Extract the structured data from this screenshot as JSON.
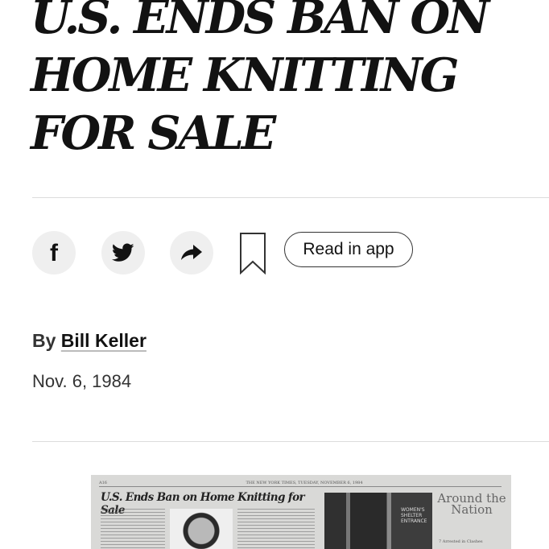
{
  "article": {
    "headline": "U.S. ENDS BAN ON HOME KNITTING FOR SALE",
    "byline_prefix": "By",
    "author": "Bill Keller",
    "date": "Nov. 6, 1984"
  },
  "share_bar": {
    "facebook_icon": "f",
    "read_in_app_label": "Read in app",
    "icons": [
      "facebook-icon",
      "twitter-icon",
      "share-arrow-icon",
      "bookmark-icon"
    ]
  },
  "clipping": {
    "page_header": "THE NEW YORK TIMES, TUESDAY, NOVEMBER 6, 1984",
    "page_number": "A16",
    "title": "U.S. Ends Ban on Home Knitting for Sale",
    "sign_text": "WOMEN'S SHELTER ENTRANCE",
    "nation_label": "Around the Nation",
    "nation_sub": "7 Arrested in Clashes"
  },
  "colors": {
    "text": "#121212",
    "circle_bg": "#efefef",
    "rule": "#dcdcdc",
    "clipping_bg": "#d9d9d7"
  }
}
